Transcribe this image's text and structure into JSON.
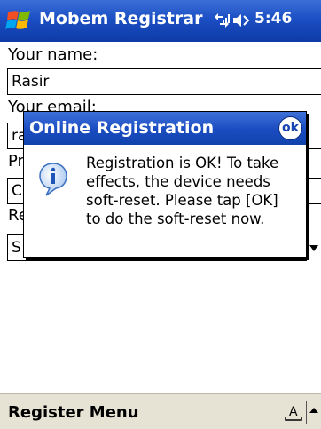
{
  "titlebar": {
    "app_title": "Mobem Registrar",
    "clock": "5:46",
    "start_icon": "windows-flag-icon",
    "connectivity_icon": "connectivity-icon",
    "volume_icon": "volume-icon",
    "bar_color": "#1b4fc4"
  },
  "form": {
    "name_label": "Your name:",
    "name_value": "Rasir",
    "email_label": "Your email:",
    "email_value": "ra",
    "row3_label": "Pr",
    "row3_value": "C",
    "row4_label": "Re",
    "row4_value": "S"
  },
  "dialog": {
    "title": "Online Registration",
    "ok_label": "ok",
    "message": "Registration is OK! To take\neffects, the device needs\nsoft-reset. Please tap [OK]\nto do the soft-reset now.",
    "icon": "info-icon"
  },
  "menubar": {
    "menu_label": "Register Menu",
    "sip_icon": "keyboard-input-icon",
    "sip_arrow_icon": "chevron-up-icon",
    "bar_color": "#e6e2d4"
  }
}
